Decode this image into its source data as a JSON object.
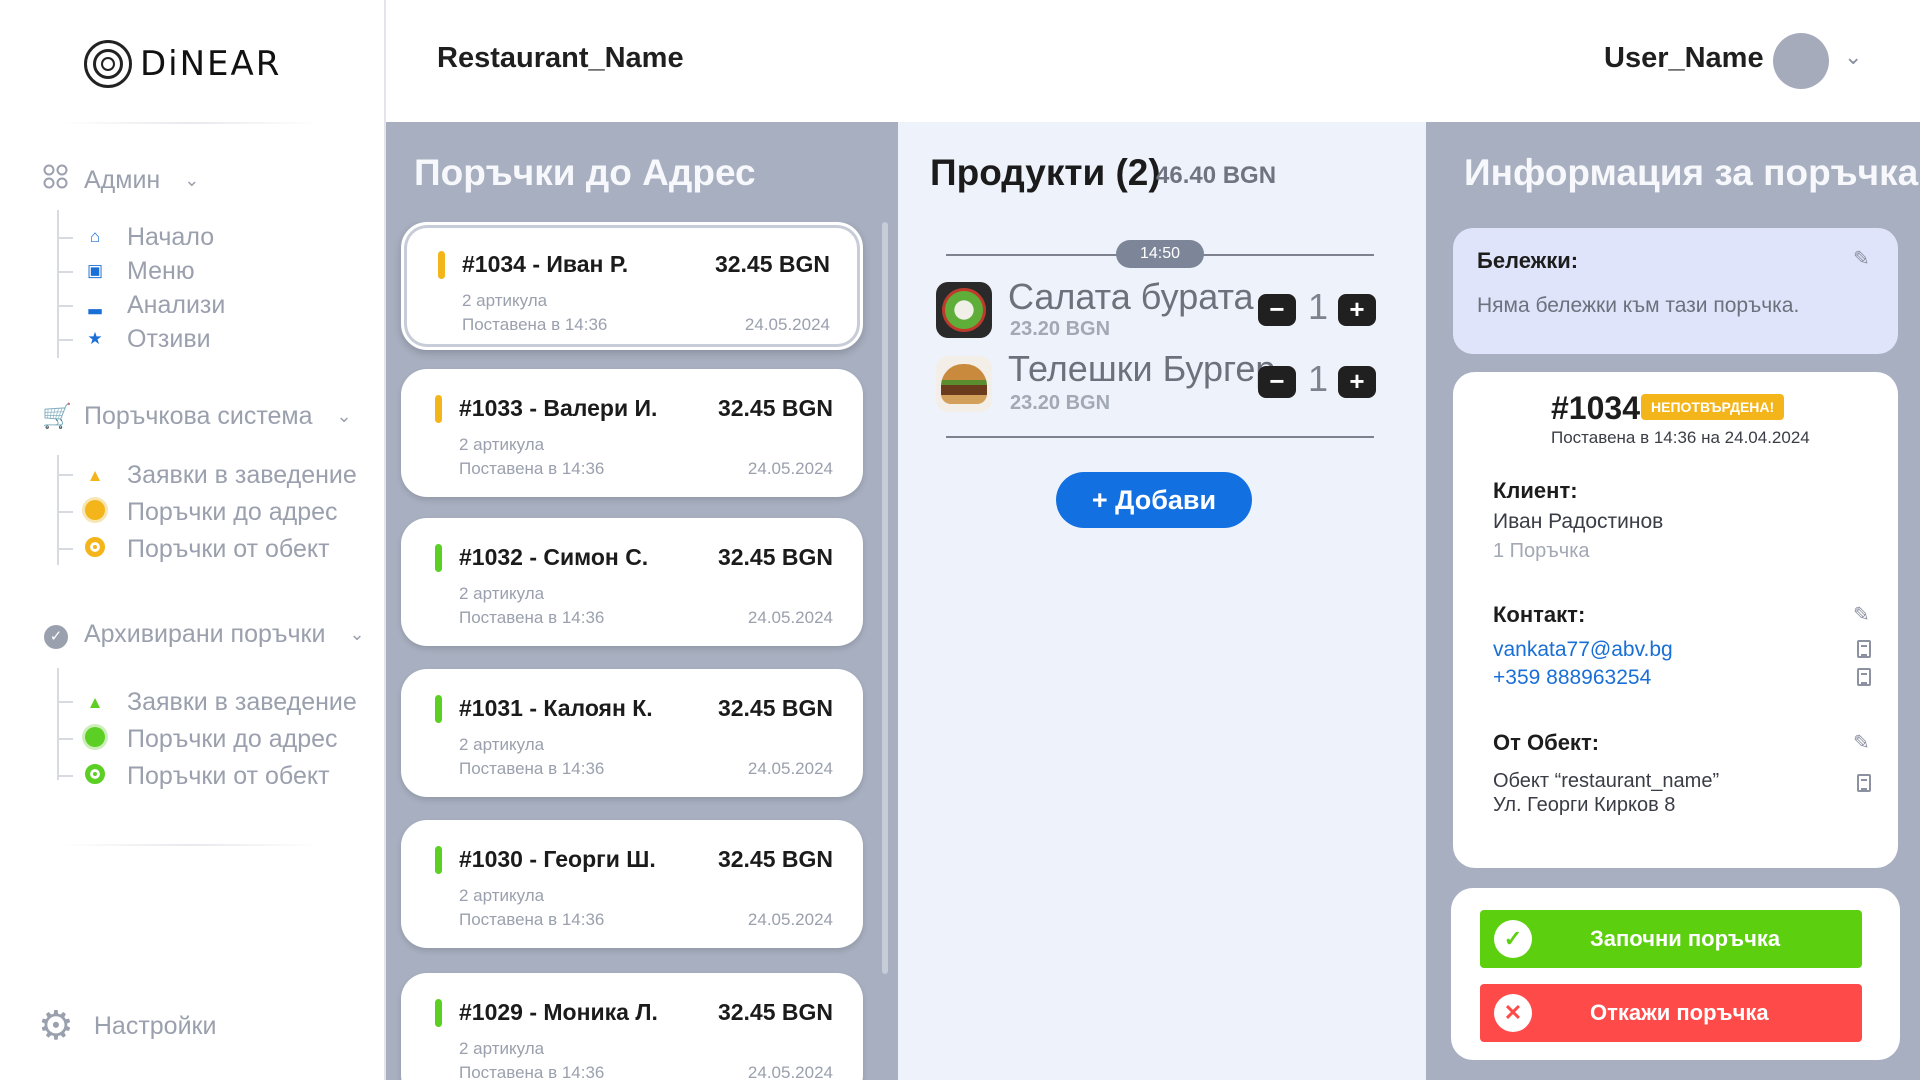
{
  "app": {
    "logo_text": "DiNEAR"
  },
  "header": {
    "restaurant_name": "Restaurant_Name",
    "user_name": "User_Name"
  },
  "sidebar": {
    "admin": {
      "title": "Админ",
      "items": [
        {
          "label": "Начало",
          "icon": "home-icon",
          "color": "#1a6fd6"
        },
        {
          "label": "Меню",
          "icon": "menu-icon",
          "color": "#1a6fd6"
        },
        {
          "label": "Анализи",
          "icon": "analytics-icon",
          "color": "#1a6fd6"
        },
        {
          "label": "Отзиви",
          "icon": "star-icon",
          "color": "#1a6fd6"
        }
      ]
    },
    "orders": {
      "title": "Поръчкова система",
      "items": [
        {
          "label": "Заявки в заведение",
          "icon": "bell-icon",
          "color": "#f4b51a"
        },
        {
          "label": "Поръчки до адрес",
          "icon": "delivery-icon",
          "color": "#f4b51a"
        },
        {
          "label": "Поръчки от обект",
          "icon": "pin-icon",
          "color": "#f4b51a"
        }
      ]
    },
    "archived": {
      "title": "Архивирани поръчки",
      "items": [
        {
          "label": "Заявки в заведение",
          "icon": "bell-icon",
          "color": "#5ccf24"
        },
        {
          "label": "Поръчки до адрес",
          "icon": "delivery-icon",
          "color": "#5ccf24"
        },
        {
          "label": "Поръчки от обект",
          "icon": "pin-icon",
          "color": "#5ccf24"
        }
      ]
    },
    "settings": "Настройки"
  },
  "orders_column": {
    "title": "Поръчки до Адрес",
    "orders": [
      {
        "title": "#1034 - Иван Р.",
        "price": "32.45 BGN",
        "items": "2 артикула",
        "placed": "Поставена в 14:36",
        "date": "24.05.2024",
        "status_color": "#f4b51a",
        "selected": true
      },
      {
        "title": "#1033 - Валери И.",
        "price": "32.45 BGN",
        "items": "2 артикула",
        "placed": "Поставена в 14:36",
        "date": "24.05.2024",
        "status_color": "#f4b51a"
      },
      {
        "title": "#1032 - Симон С.",
        "price": "32.45 BGN",
        "items": "2 артикула",
        "placed": "Поставена в 14:36",
        "date": "24.05.2024",
        "status_color": "#5ccf24"
      },
      {
        "title": "#1031 - Калоян К.",
        "price": "32.45 BGN",
        "items": "2 артикула",
        "placed": "Поставена в 14:36",
        "date": "24.05.2024",
        "status_color": "#5ccf24"
      },
      {
        "title": "#1030 - Георги Ш.",
        "price": "32.45 BGN",
        "items": "2 артикула",
        "placed": "Поставена в 14:36",
        "date": "24.05.2024",
        "status_color": "#5ccf24"
      },
      {
        "title": "#1029 - Моника Л.",
        "price": "32.45 BGN",
        "items": "2 артикула",
        "placed": "Поставена в 14:36",
        "date": "24.05.2024",
        "status_color": "#5ccf24"
      }
    ]
  },
  "products": {
    "title": "Продукти (2)",
    "total": "46.40 BGN",
    "time": "14:50",
    "items": [
      {
        "name": "Салата бурата",
        "price": "23.20 BGN",
        "qty": "1",
        "minus": "−",
        "plus": "+"
      },
      {
        "name": "Телешки Бургер",
        "price": "23.20 BGN",
        "qty": "1",
        "minus": "−",
        "plus": "+"
      }
    ],
    "add_label": "+ Добави"
  },
  "info": {
    "title": "Информация за поръчка",
    "notes_label": "Бележки:",
    "notes_text": "Няма бележки към тази поръчка.",
    "order_number": "#1034",
    "status": "НЕПОТВЪРДЕНА!",
    "placed": "Поставена в 14:36 на 24.04.2024",
    "client_label": "Клиент:",
    "client_name": "Иван Радостинов",
    "client_orders": "1 Поръчка",
    "contact_label": "Контакт:",
    "email": "vankata77@abv.bg",
    "phone": "+359 888963254",
    "object_label": "От Обект:",
    "object_name": "Обект “restaurant_name”",
    "object_address": "Ул. Георги Кирков 8",
    "start_label": "Започни поръчка",
    "cancel_label": "Откажи поръчка",
    "start_color": "#5ccf0f",
    "cancel_color": "#ff4a4a"
  }
}
